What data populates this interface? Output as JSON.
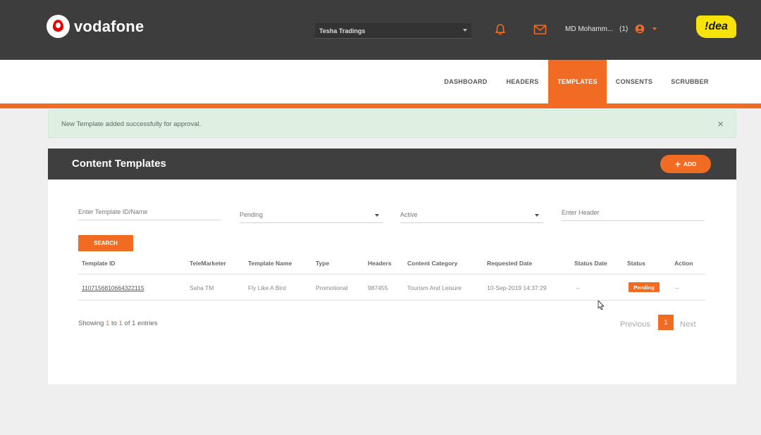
{
  "header": {
    "brand": "vodafone",
    "company_select": "Tesha Tradings",
    "user_name": "MD Mohamm...",
    "user_count": "(1)",
    "partner_logo": "!dea",
    "icons": {
      "notifications": "bell-icon",
      "messages": "mail-icon",
      "user": "user-circle-icon"
    }
  },
  "nav": {
    "items": [
      {
        "label": "DASHBOARD",
        "active": false
      },
      {
        "label": "HEADERS",
        "active": false
      },
      {
        "label": "TEMPLATES",
        "active": true
      },
      {
        "label": "CONSENTS",
        "active": false
      },
      {
        "label": "SCRUBBER",
        "active": false
      }
    ]
  },
  "alert": {
    "message": "New Template added successfully for approval.",
    "close": "×"
  },
  "card": {
    "title": "Content Templates",
    "add_label": "ADD"
  },
  "filters": {
    "template_placeholder": "Enter Template ID/Name",
    "status_select": "Pending",
    "activity_select": "Active",
    "header_placeholder": "Enter Header",
    "search_label": "SEARCH"
  },
  "table": {
    "columns": [
      "Template ID",
      "TeleMarketer",
      "Template Name",
      "Type",
      "Headers",
      "Content Category",
      "Requested Date",
      "Status Date",
      "Status",
      "Action"
    ],
    "rows": [
      {
        "template_id": "1107156810664322115",
        "telemarketer": "Saha TM",
        "template_name": "Fly Like A Bird",
        "type": "Promotional",
        "headers": "987455",
        "content_category": "Tourism And Leisure",
        "requested_date": "10-Sep-2019 14:37:29",
        "status_date": "--",
        "status": "Pending",
        "action": "--"
      }
    ]
  },
  "pagination": {
    "showing_prefix": "Showing",
    "from": "1",
    "to_word": "to",
    "to": "1",
    "of_word": "of",
    "total": "1",
    "entries_word": "entries",
    "previous": "Previous",
    "page": "1",
    "next": "Next"
  },
  "colors": {
    "accent": "#f26b22",
    "header_bg": "#3d3d3d",
    "alert_bg": "#dff0e3"
  }
}
